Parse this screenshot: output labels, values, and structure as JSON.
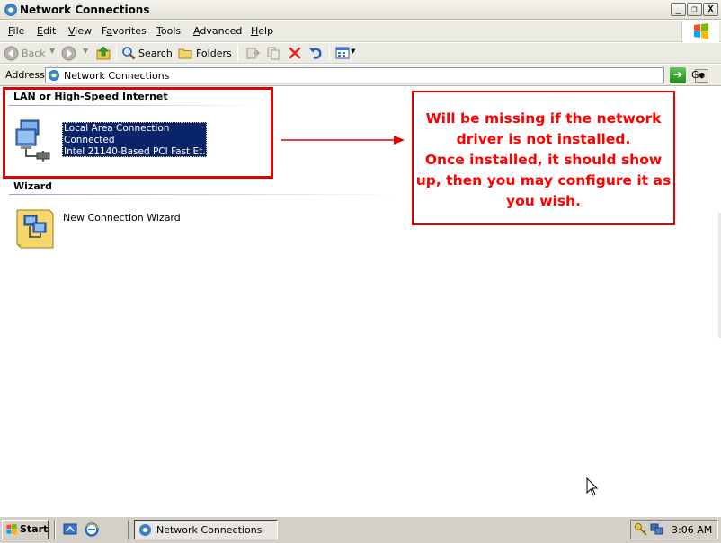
{
  "window": {
    "title": "Network Connections",
    "buttons": {
      "minimize": "_",
      "maximize": "❐",
      "close": "X"
    }
  },
  "menu": {
    "items": [
      "File",
      "Edit",
      "View",
      "Favorites",
      "Tools",
      "Advanced",
      "Help"
    ],
    "underline": [
      "F",
      "E",
      "V",
      "a",
      "T",
      "A",
      "H"
    ]
  },
  "toolbar": {
    "back": "Back",
    "search": "Search",
    "folders": "Folders"
  },
  "address": {
    "label": "Address",
    "value": "Network Connections",
    "go": "Go"
  },
  "groups": {
    "lan": {
      "heading": "LAN or High-Speed Internet",
      "item": {
        "name": "Local Area Connection",
        "status": "Connected",
        "device": "Intel 21140-Based PCI Fast Et..."
      }
    },
    "wizard": {
      "heading": "Wizard",
      "item": {
        "name": "New Connection Wizard"
      }
    }
  },
  "annotation": {
    "lines": [
      "Will be missing if the network",
      "driver is not installed.",
      "Once installed, it should show",
      "up, then you may configure it as",
      "you wish."
    ],
    "color": "#ff0000"
  },
  "taskbar": {
    "start": "Start",
    "task": "Network Connections",
    "clock": "3:06 AM"
  }
}
